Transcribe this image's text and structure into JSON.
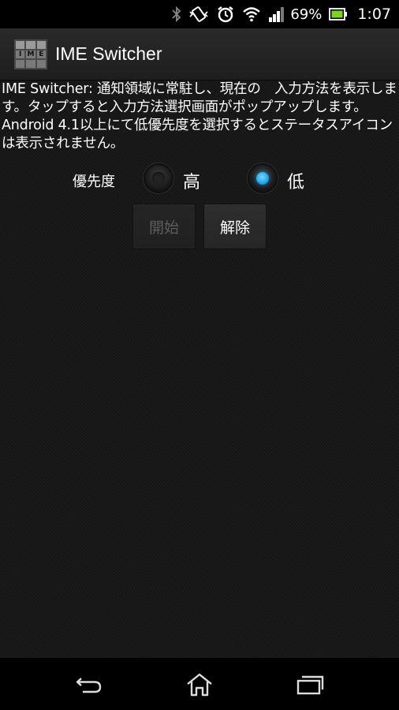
{
  "status_bar": {
    "battery_percent": "69%",
    "time": "1:07",
    "icons": [
      "bluetooth-icon",
      "vibrate-icon",
      "alarm-icon",
      "wifi-icon",
      "signal-icon",
      "battery-icon"
    ]
  },
  "action_bar": {
    "title": "IME Switcher",
    "icon_letters": [
      "I",
      "M",
      "E"
    ]
  },
  "main": {
    "description": "IME Switcher: 通知領域に常駐し、現在の　入力方法を表示します。タップすると入力方法選択画面がポップアップします。Android 4.1以上にて低優先度を選択するとステータスアイコンは表示されません。",
    "priority": {
      "label": "優先度",
      "options": [
        {
          "label": "高",
          "checked": false
        },
        {
          "label": "低",
          "checked": true
        }
      ]
    },
    "buttons": {
      "start_label": "開始",
      "start_enabled": false,
      "stop_label": "解除",
      "stop_enabled": true
    }
  },
  "nav_bar": {
    "icons": [
      "back-icon",
      "home-icon",
      "recent-apps-icon"
    ]
  },
  "colors": {
    "accent": "#1ba6ec",
    "background": "#151515",
    "text": "#ffffff",
    "disabled_text": "#5d5d5d"
  }
}
